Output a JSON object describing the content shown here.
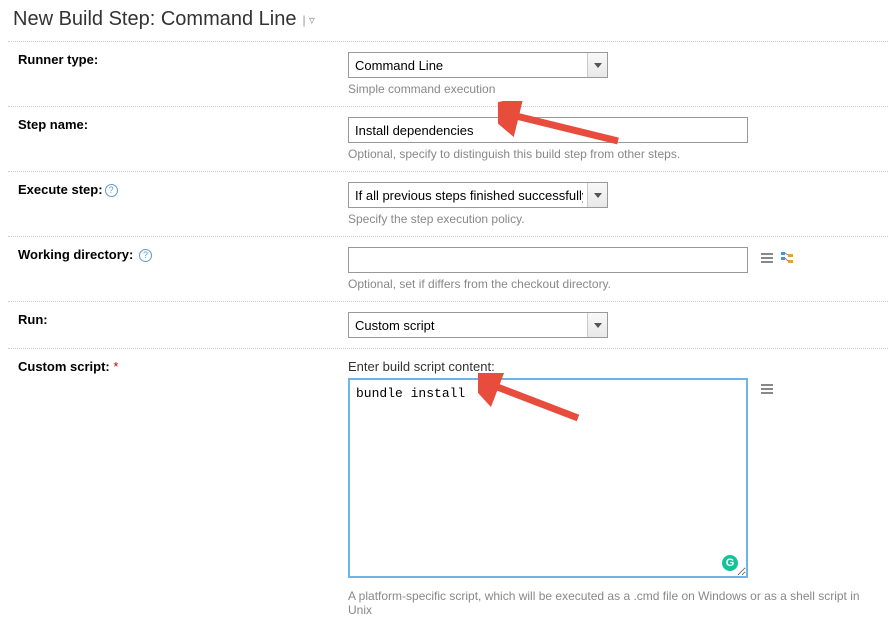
{
  "title": "New Build Step: Command Line",
  "runner_type": {
    "label": "Runner type:",
    "value": "Command Line",
    "help": "Simple command execution"
  },
  "step_name": {
    "label": "Step name:",
    "value": "Install dependencies",
    "help": "Optional, specify to distinguish this build step from other steps."
  },
  "execute_step": {
    "label": "Execute step:",
    "value": "If all previous steps finished successfully",
    "help": "Specify the step execution policy."
  },
  "working_directory": {
    "label": "Working directory:",
    "value": "",
    "help": "Optional, set if differs from the checkout directory."
  },
  "run": {
    "label": "Run:",
    "value": "Custom script"
  },
  "custom_script": {
    "label": "Custom script:",
    "script_label": "Enter build script content:",
    "value": "bundle install",
    "help": "A platform-specific script, which will be executed as a .cmd file on Windows or as a shell script in Unix"
  }
}
